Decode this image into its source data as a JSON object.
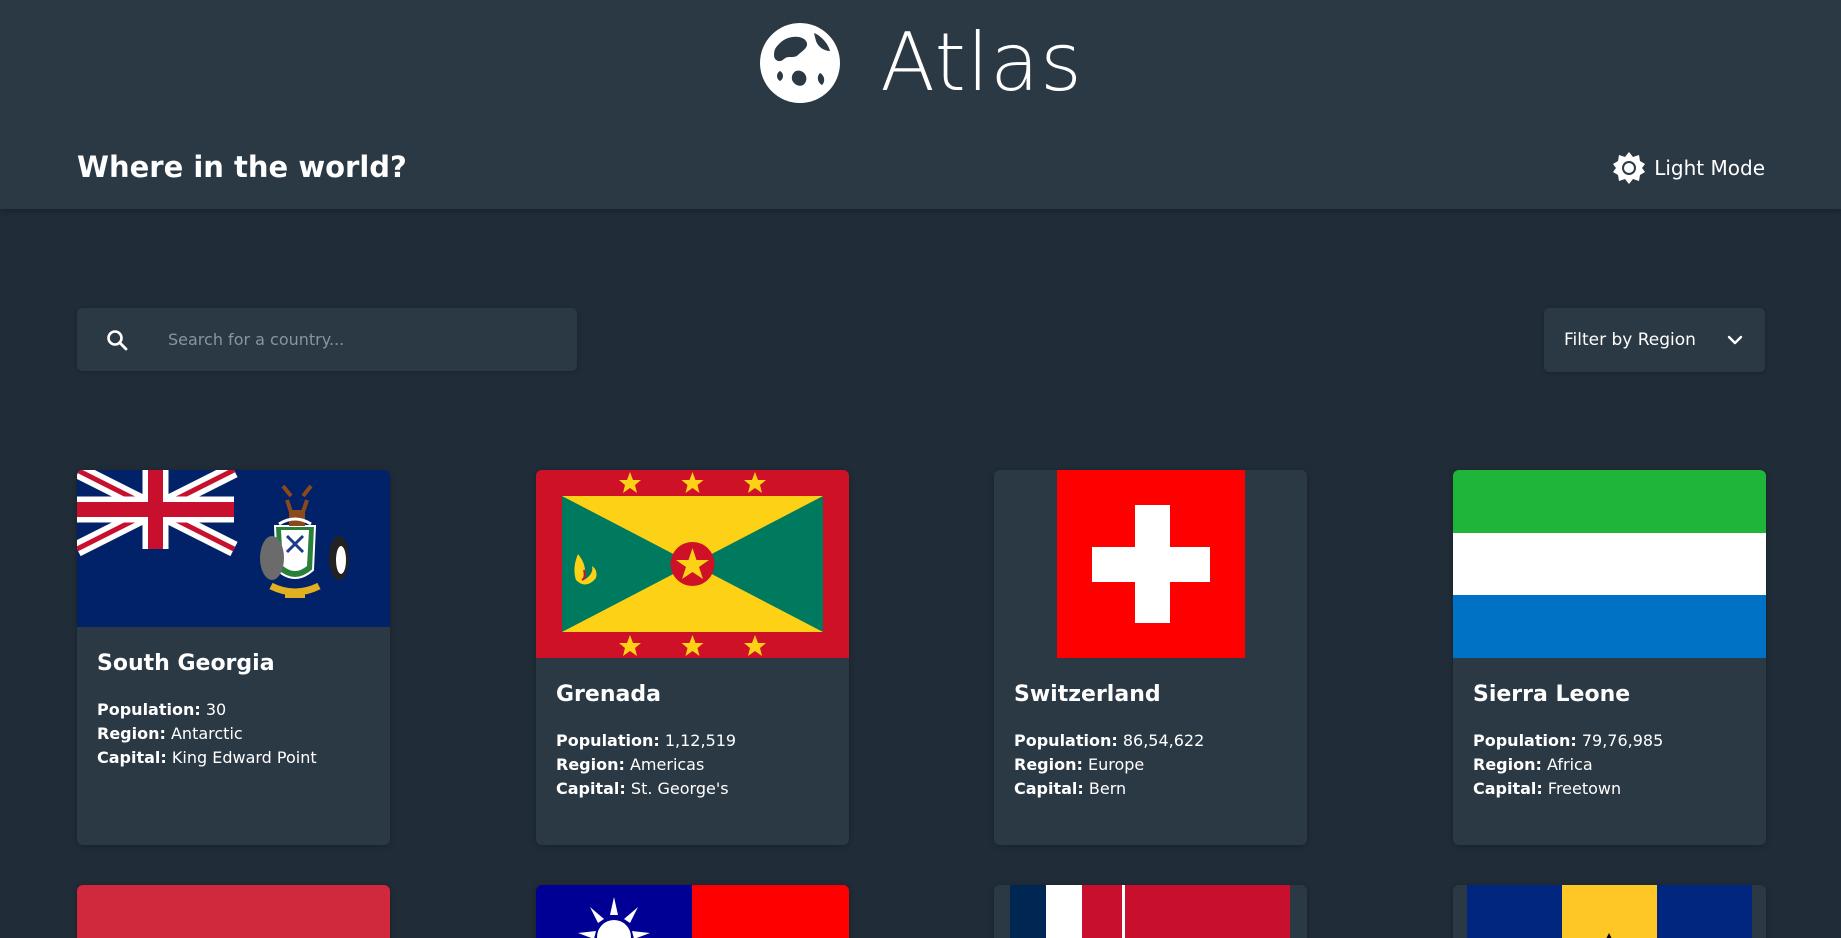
{
  "brand": {
    "name": "Atlas",
    "logo_icon": "globe-icon"
  },
  "header": {
    "tagline": "Where in the world?",
    "theme_toggle_label": "Light Mode",
    "theme_icon": "sun-icon"
  },
  "search": {
    "placeholder": "Search for a country...",
    "value": "",
    "icon": "search-icon"
  },
  "filter": {
    "label": "Filter by Region",
    "icon": "chevron-down-icon"
  },
  "labels": {
    "population": "Population:",
    "region": "Region:",
    "capital": "Capital:"
  },
  "countries": [
    {
      "name": "South Georgia",
      "population": "30",
      "region": "Antarctic",
      "capital": "King Edward Point"
    },
    {
      "name": "Grenada",
      "population": "1,12,519",
      "region": "Americas",
      "capital": "St. George's"
    },
    {
      "name": "Switzerland",
      "population": "86,54,622",
      "region": "Europe",
      "capital": "Bern"
    },
    {
      "name": "Sierra Leone",
      "population": "79,76,985",
      "region": "Africa",
      "capital": "Freetown"
    }
  ],
  "colors": {
    "background": "#202c37",
    "element": "#2b3945",
    "text": "#ffffff"
  }
}
